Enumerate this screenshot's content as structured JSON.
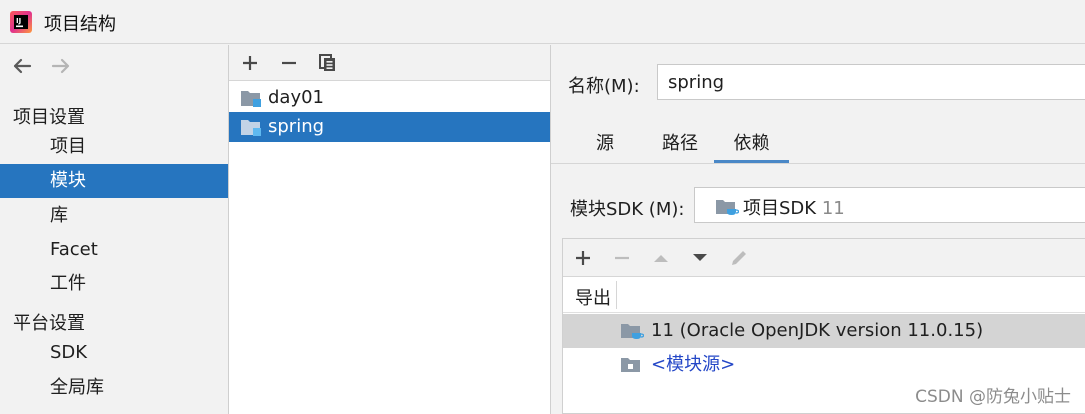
{
  "window": {
    "title": "项目结构"
  },
  "nav": {
    "back_icon": "arrow-left-icon",
    "forward_icon": "arrow-right-icon",
    "project_settings_header": "项目设置",
    "project_settings_items": [
      "项目",
      "模块",
      "库",
      "Facet",
      "工件"
    ],
    "selected_item": "模块",
    "platform_settings_header": "平台设置",
    "platform_settings_items": [
      "SDK",
      "全局库"
    ]
  },
  "modules": {
    "toolbar_icons": [
      "plus-icon",
      "minus-icon",
      "copy-icon"
    ],
    "items": [
      "day01",
      "spring"
    ],
    "selected": "spring"
  },
  "details": {
    "name_label": "名称(M):",
    "name_value": "spring",
    "tabs": [
      "源",
      "路径",
      "依赖"
    ],
    "active_tab": "依赖",
    "sdk_label": "模块SDK (M):",
    "sdk_value": "项目SDK",
    "sdk_version": "11",
    "dependency_toolbar_icons": [
      "plus-icon",
      "minus-icon",
      "move-up-icon",
      "move-down-icon",
      "edit-pencil-icon"
    ],
    "export_column_header": "导出",
    "dependencies": [
      {
        "label": "11 (Oracle OpenJDK version 11.0.15)",
        "selected": true
      },
      {
        "label": "<模块源>",
        "selected": false
      }
    ]
  },
  "watermark": "CSDN @防兔小贴士",
  "colors": {
    "selection_blue": "#2675bf",
    "panel_bg": "#f2f2f2",
    "link_blue": "#2447c7",
    "row_selected_gray": "#d4d4d4",
    "folder_gray": "#8b98a6",
    "module_badge_blue": "#3fa0e0"
  }
}
